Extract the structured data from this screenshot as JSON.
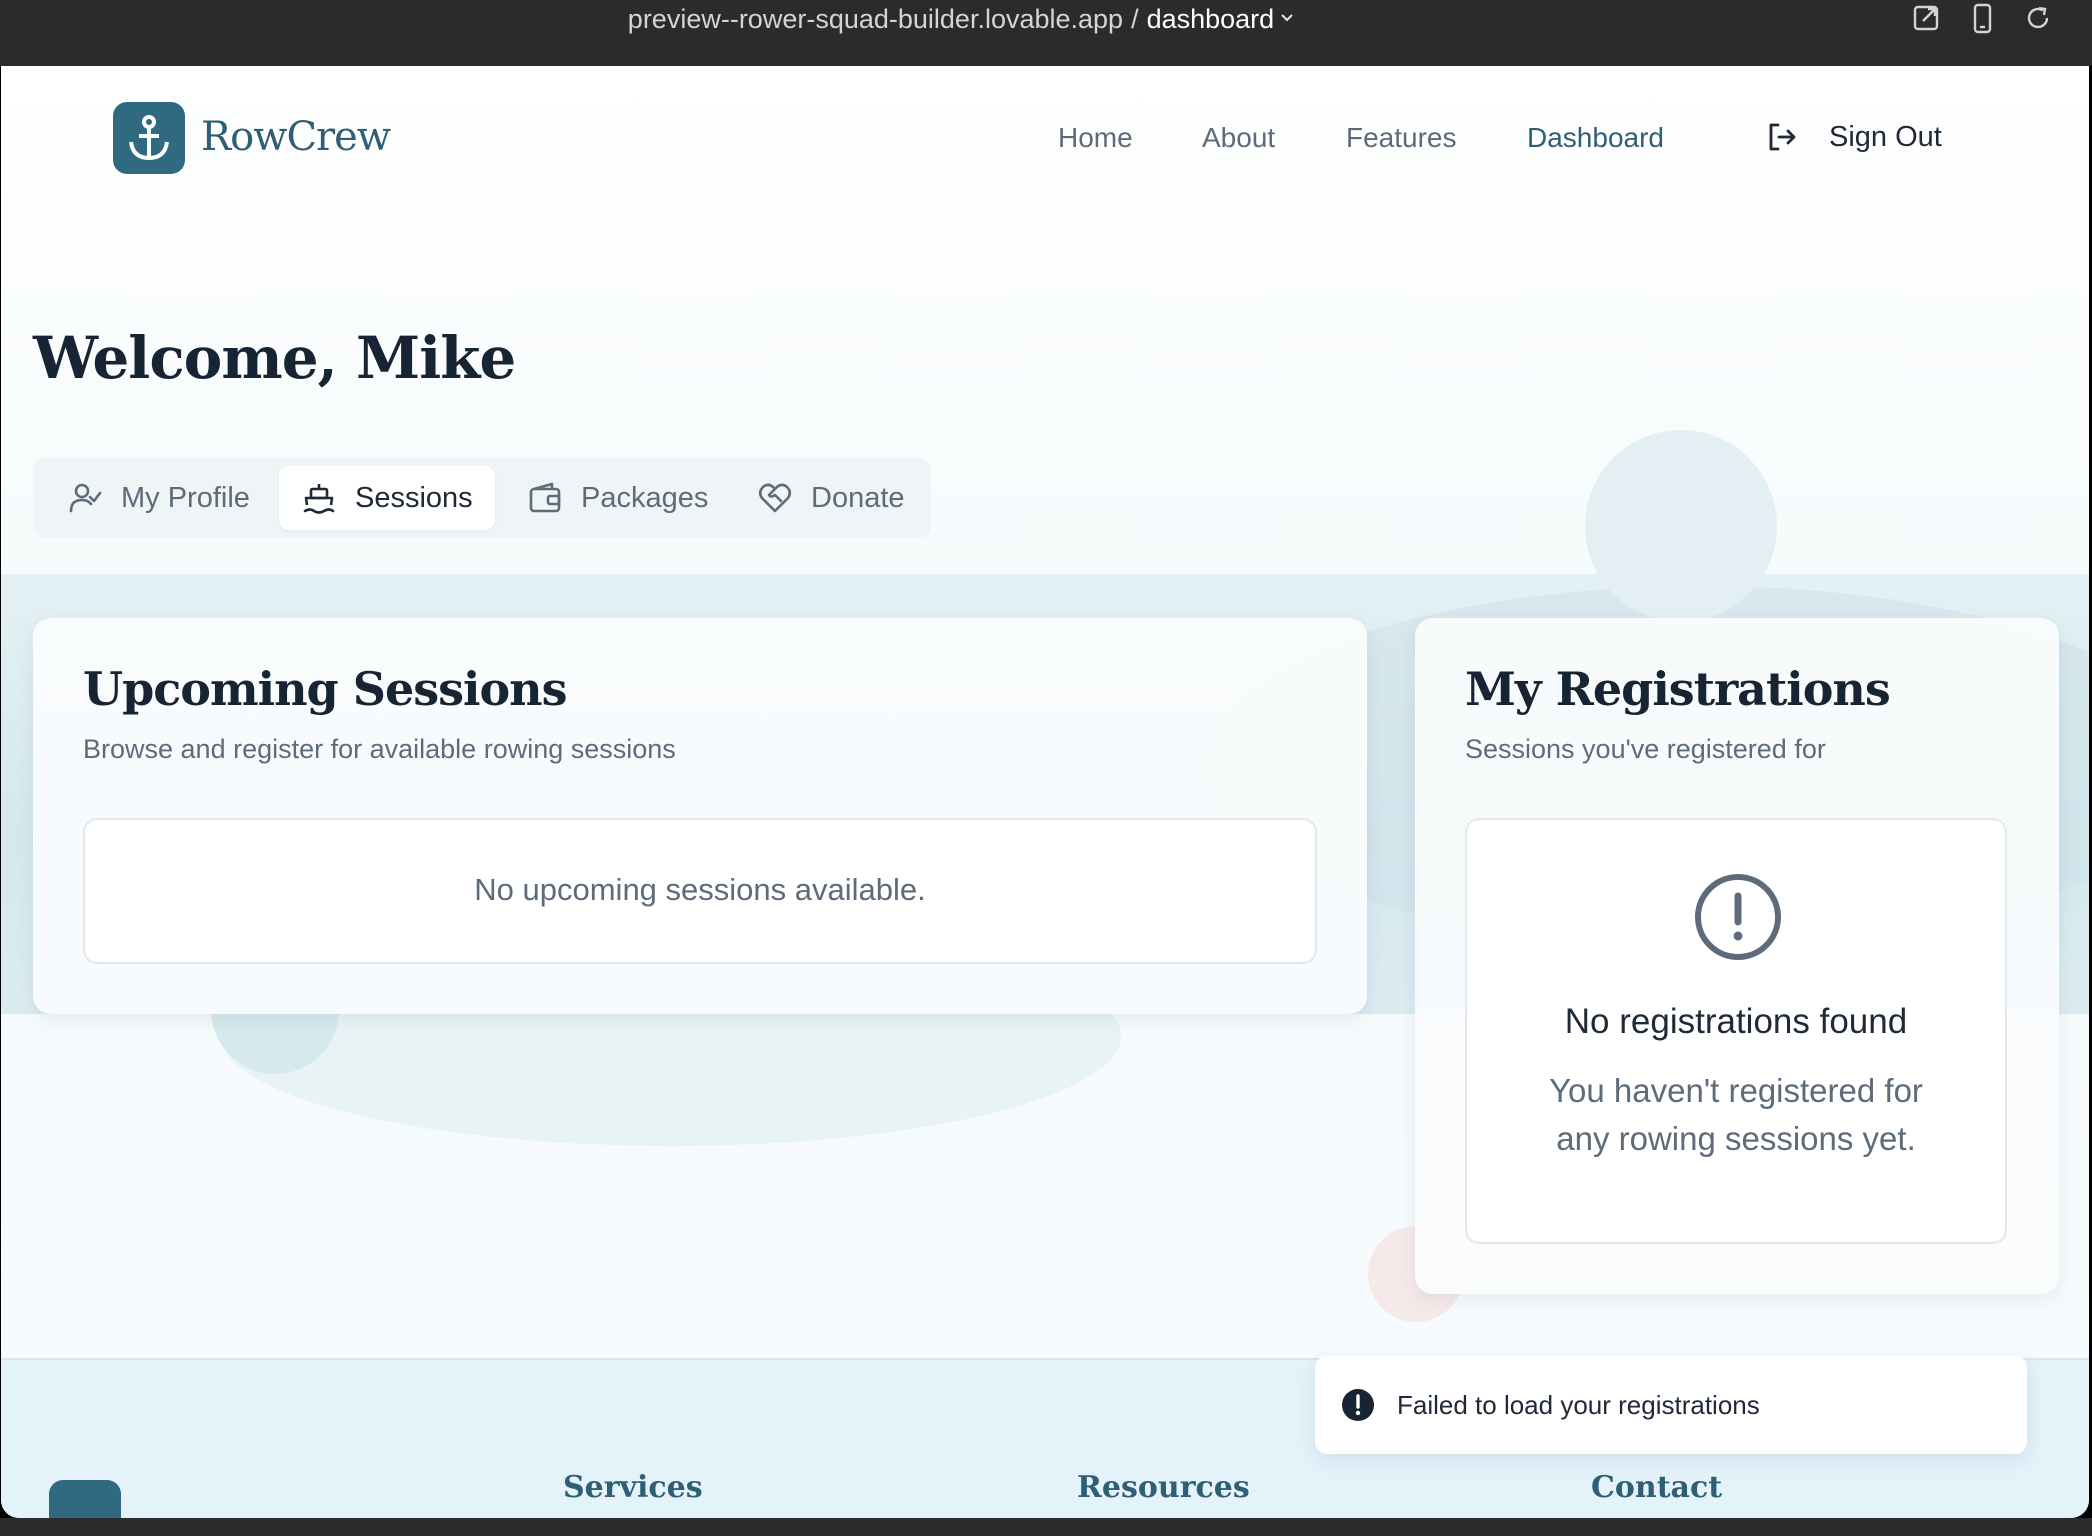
{
  "browser": {
    "url_host": "preview--rower-squad-builder.lovable.app",
    "url_separator": "/",
    "url_route": "dashboard",
    "icons": [
      "open-external-icon",
      "mobile-preview-icon",
      "reload-icon"
    ]
  },
  "nav": {
    "brand": "RowCrew",
    "links": [
      "Home",
      "About",
      "Features",
      "Dashboard"
    ],
    "active_link": "Dashboard",
    "sign_out": "Sign Out"
  },
  "page": {
    "welcome": "Welcome, Mike"
  },
  "tabs": [
    {
      "label": "My Profile",
      "icon": "user-check-icon"
    },
    {
      "label": "Sessions",
      "icon": "ship-icon"
    },
    {
      "label": "Packages",
      "icon": "wallet-icon"
    },
    {
      "label": "Donate",
      "icon": "heart-handshake-icon"
    }
  ],
  "active_tab": "Sessions",
  "upcoming": {
    "title": "Upcoming Sessions",
    "subtitle": "Browse and register for available rowing sessions",
    "empty": "No upcoming sessions available."
  },
  "registrations": {
    "title": "My Registrations",
    "subtitle": "Sessions you've registered for",
    "empty_title": "No registrations found",
    "empty_line1": "You haven't registered for",
    "empty_line2": "any rowing sessions yet."
  },
  "toast": {
    "message": "Failed to load your registrations",
    "icon": "alert-circle-icon"
  },
  "footer": {
    "headings": [
      "Services",
      "Resources",
      "Contact"
    ]
  },
  "colors": {
    "brand": "#2f6a80",
    "heading": "#172433",
    "muted": "#5d6b7a"
  }
}
